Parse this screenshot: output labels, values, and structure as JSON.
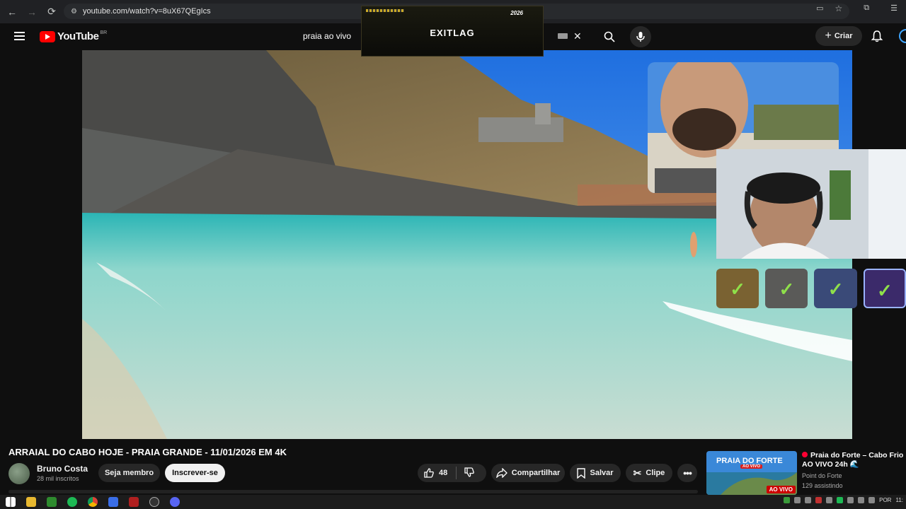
{
  "browser": {
    "url": "youtube.com/watch?v=8uX67QEgIcs"
  },
  "youtube": {
    "logo_text": "YouTube",
    "country": "BR",
    "search_value": "praia ao vivo",
    "create_label": "Criar"
  },
  "overlay": {
    "brand": "EXITLAG",
    "year": "2026"
  },
  "video": {
    "title": "ARRAIAL DO CABO HOJE - PRAIA GRANDE - 11/01/2026 EM 4K"
  },
  "channel": {
    "name": "Bruno Costa",
    "subscribers": "28 mil inscritos",
    "member_label": "Seja membro",
    "subscribe_label": "Inscrever-se"
  },
  "actions": {
    "likes": "48",
    "share_label": "Compartilhar",
    "save_label": "Salvar",
    "clip_label": "Clipe"
  },
  "recommendation": {
    "title": "Praia do Forte – Cabo Frio AO VIVO 24h 🌊",
    "channel": "Point do Forte",
    "viewers": "129 assistindo",
    "thumb_title": "PRAIA DO FORTE",
    "thumb_sub": "AO VIVO",
    "live_badge": "AO VIVO"
  },
  "taskbar": {
    "lang": "POR",
    "time": "11:"
  },
  "colors": {
    "yt_red": "#ff0000",
    "bg": "#0f0f0f",
    "check_green": "#8fe04a"
  }
}
